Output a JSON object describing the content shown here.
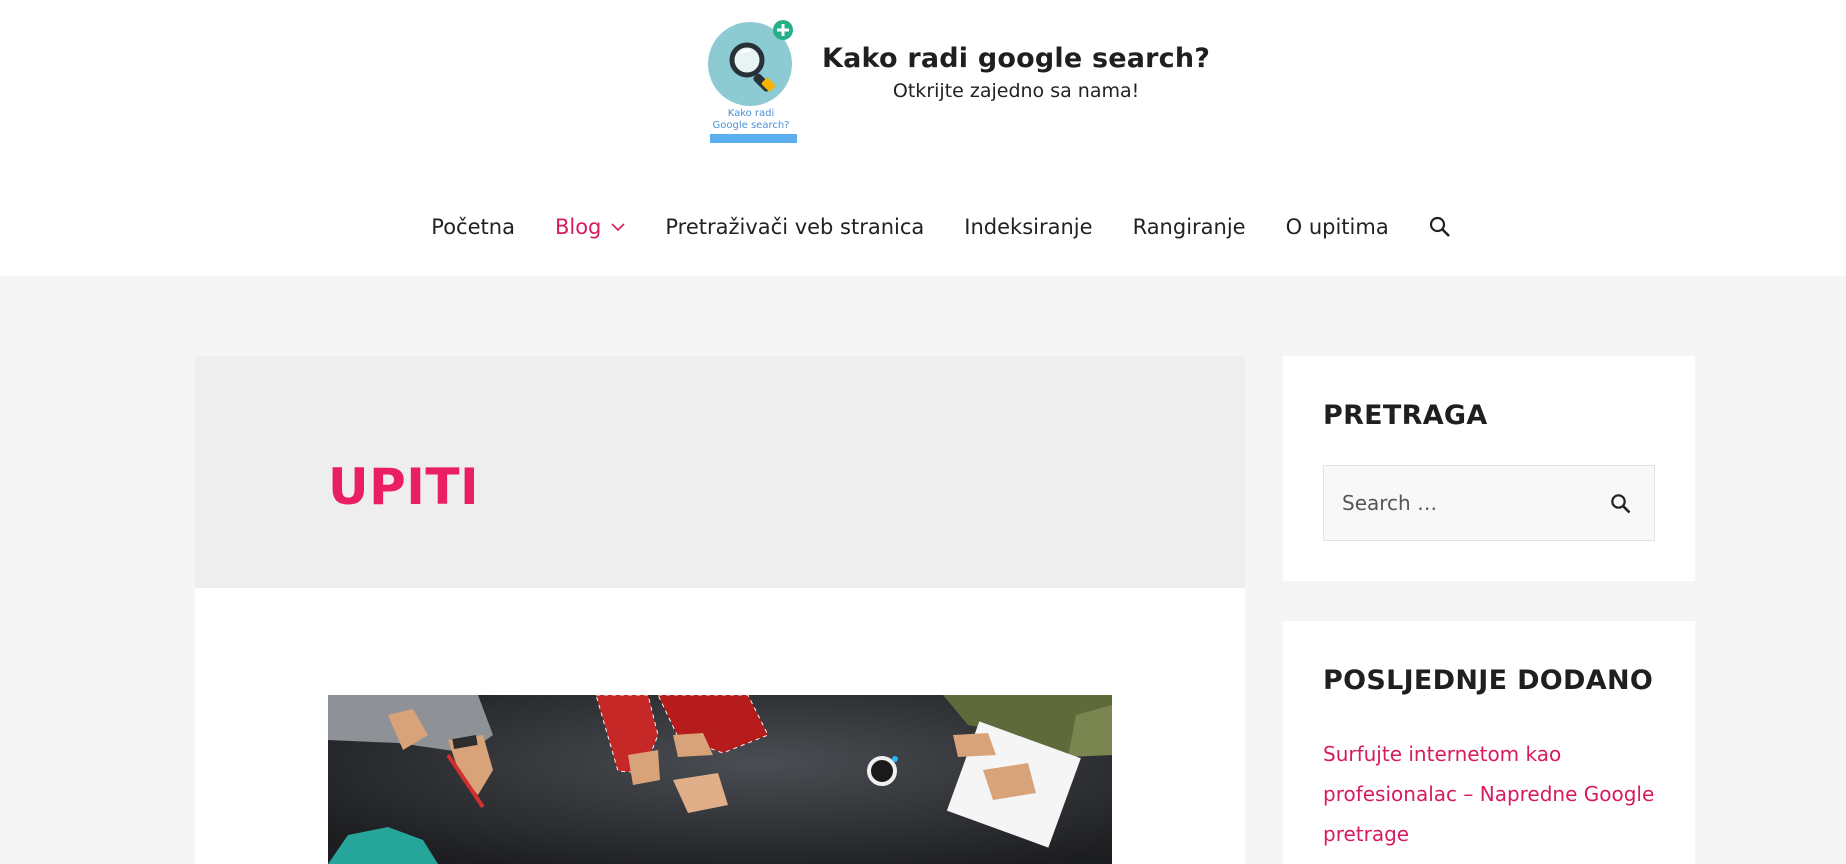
{
  "site": {
    "title": "Kako radi google search?",
    "tagline": "Otkrijte zajedno sa nama!",
    "logo_text_line1": "Kako radi",
    "logo_text_line2": "Google search?"
  },
  "nav": {
    "items": [
      {
        "label": "Početna"
      },
      {
        "label": "Blog"
      },
      {
        "label": "Pretraživači veb stranica"
      },
      {
        "label": "Indeksiranje"
      },
      {
        "label": "Rangiranje"
      },
      {
        "label": "O upitima"
      }
    ],
    "search_icon": "search-icon"
  },
  "archive": {
    "title": "UPITI"
  },
  "sidebar": {
    "search_widget": {
      "title": "PRETRAGA",
      "placeholder": "Search …"
    },
    "recent_widget": {
      "title": "POSLJEDNJE DODANO",
      "posts": [
        "Surfujte internetom kao profesionalac – Napredne Google pretrage"
      ]
    }
  },
  "colors": {
    "accent": "#e91e63",
    "link": "#d81b60",
    "page_bg": "#f5f5f5",
    "header_bg": "#eeeeee"
  }
}
